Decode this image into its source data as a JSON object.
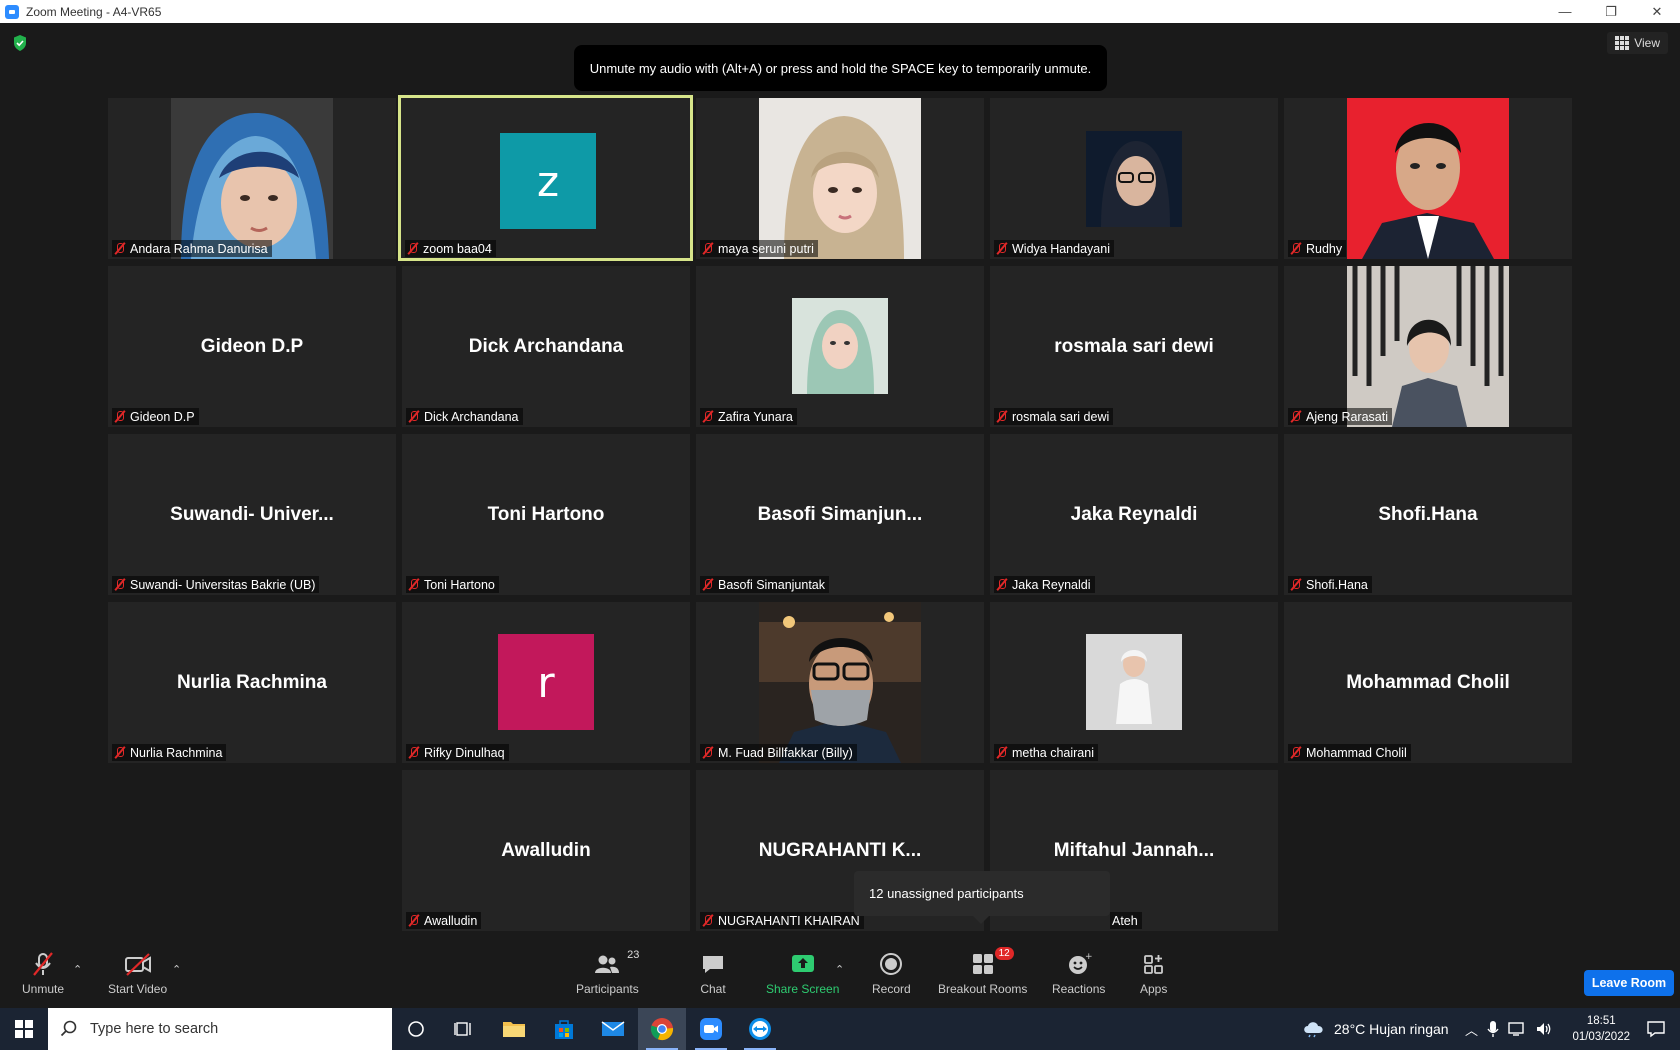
{
  "window": {
    "title": "Zoom Meeting - A4-VR65",
    "controls": [
      "—",
      "❐",
      "✕"
    ]
  },
  "view_button": "View",
  "notice": "Unmute my audio with (Alt+A) or press and hold the SPACE key to temporarily unmute.",
  "tiles": [
    {
      "label": "Andara Rahma Danurisa",
      "big": "",
      "kind": "photo",
      "active": false
    },
    {
      "label": "zoom baa04",
      "big": "",
      "kind": "avatar",
      "avatar_letter": "z",
      "avatar_color": "#0e9aa7",
      "active": true
    },
    {
      "label": "maya seruni putri",
      "big": "",
      "kind": "photo",
      "active": false
    },
    {
      "label": "Widya Handayani",
      "big": "",
      "kind": "photo-small",
      "active": false
    },
    {
      "label": "Rudhy",
      "big": "",
      "kind": "photo",
      "active": false
    },
    {
      "label": "Gideon D.P",
      "big": "Gideon D.P",
      "kind": "name",
      "active": false
    },
    {
      "label": "Dick Archandana",
      "big": "Dick Archandana",
      "kind": "name",
      "active": false
    },
    {
      "label": "Zafira Yunara",
      "big": "",
      "kind": "photo-small",
      "active": false
    },
    {
      "label": "rosmala sari dewi",
      "big": "rosmala sari dewi",
      "kind": "name",
      "active": false
    },
    {
      "label": "Ajeng Rarasati",
      "big": "",
      "kind": "photo",
      "active": false
    },
    {
      "label": "Suwandi- Universitas Bakrie (UB)",
      "big": "Suwandi-  Univer...",
      "kind": "name",
      "active": false
    },
    {
      "label": "Toni Hartono",
      "big": "Toni Hartono",
      "kind": "name",
      "active": false
    },
    {
      "label": "Basofi Simanjuntak",
      "big": "Basofi  Simanjun...",
      "kind": "name",
      "active": false
    },
    {
      "label": "Jaka Reynaldi",
      "big": "Jaka Reynaldi",
      "kind": "name",
      "active": false
    },
    {
      "label": "Shofi.Hana",
      "big": "Shofi.Hana",
      "kind": "name",
      "active": false
    },
    {
      "label": "Nurlia Rachmina",
      "big": "Nurlia Rachmina",
      "kind": "name",
      "active": false
    },
    {
      "label": "Rifky Dinulhaq",
      "big": "",
      "kind": "avatar",
      "avatar_letter": "r",
      "avatar_color": "#c2185b",
      "active": false
    },
    {
      "label": "M. Fuad Billfakkar (Billy)",
      "big": "",
      "kind": "photo",
      "active": false
    },
    {
      "label": "metha chairani",
      "big": "",
      "kind": "photo-small",
      "active": false
    },
    {
      "label": "Mohammad Cholil",
      "big": "Mohammad Cholil",
      "kind": "name",
      "active": false
    },
    {
      "label": "Awalludin",
      "big": "Awalludin",
      "kind": "name",
      "active": false
    },
    {
      "label": "NUGRAHANTI KHAIRAN",
      "big": "NUGRAHANTI  K...",
      "kind": "name",
      "active": false
    },
    {
      "label": "Ateh",
      "big": "Miftahul  Jannah...",
      "kind": "name",
      "active": false
    }
  ],
  "popup": "12 unassigned participants",
  "toolbar": {
    "unmute": "Unmute",
    "start_video": "Start Video",
    "participants": "Participants",
    "participants_count": "23",
    "chat": "Chat",
    "share_screen": "Share Screen",
    "record": "Record",
    "breakout_rooms": "Breakout Rooms",
    "breakout_badge": "12",
    "reactions": "Reactions",
    "apps": "Apps",
    "leave_room": "Leave Room"
  },
  "taskbar": {
    "search_placeholder": "Type here to search",
    "weather": "28°C  Hujan ringan",
    "time": "18:51",
    "date": "01/03/2022"
  },
  "colors": {
    "meeting_bg": "#1a1a1a",
    "tile_bg": "#242424",
    "active_border": "#d7e58a",
    "leave_button": "#0e71eb",
    "share_green": "#2ecc71",
    "muted_red": "#e02828"
  }
}
